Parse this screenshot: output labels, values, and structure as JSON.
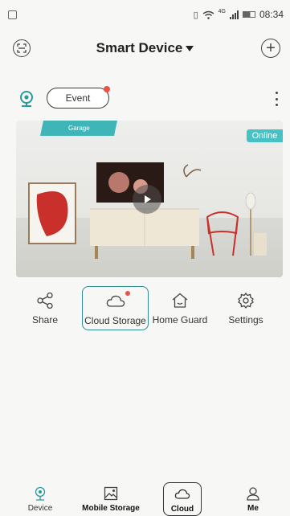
{
  "status_bar": {
    "time": "08:34",
    "network": "4G"
  },
  "header": {
    "title": "Smart Device"
  },
  "camera_row": {
    "event_label": "Event"
  },
  "preview": {
    "garage_label": "Garage",
    "online_label": "Online"
  },
  "actions": [
    {
      "label": "Share",
      "icon": "share-icon"
    },
    {
      "label": "Cloud Storage",
      "icon": "cloud-icon"
    },
    {
      "label": "Home Guard",
      "icon": "home-icon"
    },
    {
      "label": "Settings",
      "icon": "gear-icon"
    }
  ],
  "tabbar": [
    {
      "label": "Device",
      "icon": "device-icon"
    },
    {
      "label": "Mobile Storage",
      "icon": "image-icon"
    },
    {
      "label": "Cloud",
      "icon": "cloud-icon"
    },
    {
      "label": "Me",
      "icon": "person-icon"
    }
  ],
  "colors": {
    "accent": "#3fb5b8",
    "online": "#46c2c4",
    "notification": "#e8524a"
  }
}
